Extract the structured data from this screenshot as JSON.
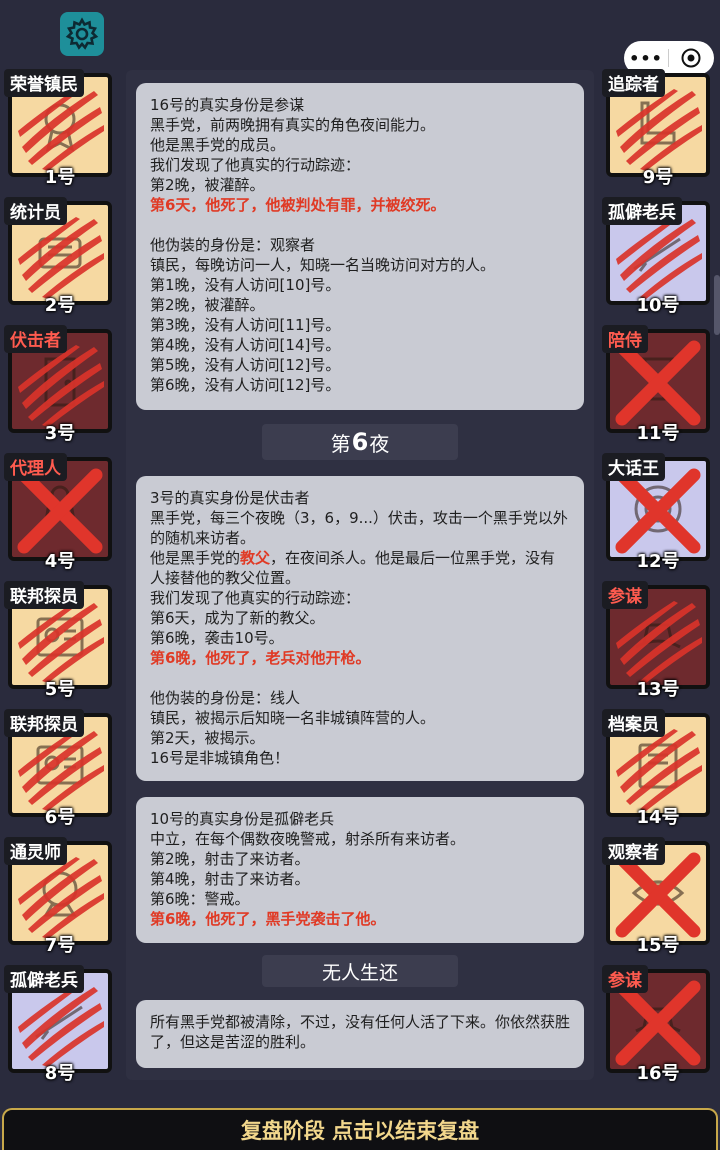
{
  "left_players": [
    {
      "role": "荣誉镇民",
      "number": "1号",
      "bg": "cream",
      "mark": "claw",
      "tag_color": "white",
      "art": "medal"
    },
    {
      "role": "统计员",
      "number": "2号",
      "bg": "cream",
      "mark": "claw",
      "tag_color": "white",
      "art": "box"
    },
    {
      "role": "伏击者",
      "number": "3号",
      "bg": "maroon",
      "mark": "claw",
      "tag_color": "red",
      "art": "door"
    },
    {
      "role": "代理人",
      "number": "4号",
      "bg": "maroon",
      "mark": "cross",
      "tag_color": "red",
      "art": "figure"
    },
    {
      "role": "联邦探员",
      "number": "5号",
      "bg": "cream",
      "mark": "claw",
      "tag_color": "white",
      "art": "badge"
    },
    {
      "role": "联邦探员",
      "number": "6号",
      "bg": "cream",
      "mark": "claw",
      "tag_color": "white",
      "art": "badge"
    },
    {
      "role": "通灵师",
      "number": "7号",
      "bg": "cream",
      "mark": "claw",
      "tag_color": "white",
      "art": "orb"
    },
    {
      "role": "孤僻老兵",
      "number": "8号",
      "bg": "lav",
      "mark": "claw",
      "tag_color": "white",
      "art": "rifle"
    }
  ],
  "right_players": [
    {
      "role": "追踪者",
      "number": "9号",
      "bg": "cream",
      "mark": "claw",
      "tag_color": "white",
      "art": "boot"
    },
    {
      "role": "孤僻老兵",
      "number": "10号",
      "bg": "lav",
      "mark": "claw",
      "tag_color": "white",
      "art": "rifle"
    },
    {
      "role": "陪侍",
      "number": "11号",
      "bg": "maroon",
      "mark": "cross",
      "tag_color": "red",
      "art": "glass"
    },
    {
      "role": "大话王",
      "number": "12号",
      "bg": "lav",
      "mark": "cross",
      "tag_color": "white",
      "art": "plate"
    },
    {
      "role": "参谋",
      "number": "13号",
      "bg": "maroon",
      "mark": "claw",
      "tag_color": "red",
      "art": "hat"
    },
    {
      "role": "档案员",
      "number": "14号",
      "bg": "cream",
      "mark": "claw",
      "tag_color": "white",
      "art": "book"
    },
    {
      "role": "观察者",
      "number": "15号",
      "bg": "cream",
      "mark": "cross",
      "tag_color": "white",
      "art": "eye"
    },
    {
      "role": "参谋",
      "number": "16号",
      "bg": "maroon",
      "mark": "cross",
      "tag_color": "red",
      "art": "hat"
    }
  ],
  "messages": {
    "m1": {
      "l1": "16号的真实身份是参谋",
      "l2": "黑手党，前两晚拥有真实的角色夜间能力。",
      "l3": "他是黑手党的成员。",
      "l4": "我们发现了他真实的行动踪迹：",
      "l5": "第2晚，被灌醉。",
      "l6": "第6天，他死了，他被判处有罪，并被绞死。",
      "l7": "他伪装的身份是：观察者",
      "l8": "镇民，每晚访问一人，知晓一名当晚访问对方的人。",
      "l9": "第1晚，没有人访问[10]号。",
      "l10": "第2晚，被灌醉。",
      "l11": "第3晚，没有人访问[11]号。",
      "l12": "第4晚，没有人访问[14]号。",
      "l13": "第5晚，没有人访问[12]号。",
      "l14": "第6晚，没有人访问[12]号。"
    },
    "night_label_pre": "第",
    "night_label_num": "6",
    "night_label_post": "夜",
    "m2": {
      "l1": "3号的真实身份是伏击者",
      "l2": "黑手党，每三个夜晚（3，6，9...）伏击，攻击一个黑手党以外的随机来访者。",
      "l3a": "他是黑手党的",
      "l3b": "教父",
      "l3c": "，在夜间杀人。他是最后一位黑手党，没有人接替他的教父位置。",
      "l4": "我们发现了他真实的行动踪迹：",
      "l5": "第6天，成为了新的教父。",
      "l6": "第6晚，袭击10号。",
      "l7": "第6晚，他死了，老兵对他开枪。",
      "l8": "他伪装的身份是：线人",
      "l9": "镇民，被揭示后知晓一名非城镇阵营的人。",
      "l10": "第2天，被揭示。",
      "l11": "16号是非城镇角色！"
    },
    "m3": {
      "l1": "10号的真实身份是孤僻老兵",
      "l2": "中立，在每个偶数夜晚警戒，射杀所有来访者。",
      "l3": "第2晚，射击了来访者。",
      "l4": "第4晚，射击了来访者。",
      "l5": "第6晚：警戒。",
      "l6": "第6晚，他死了，黑手党袭击了他。"
    },
    "survivor_label": "无人生还",
    "m4": {
      "l1": "所有黑手党都被清除，不过，没有任何人活了下来。你依然获胜了，但这是苦涩的胜利。"
    }
  },
  "bottom_button": "复盘阶段 点击以结束复盘",
  "capsule": {
    "more": "•••"
  },
  "colors": {
    "accent_red": "#e03a25",
    "gold": "#c8a84a",
    "cream": "#f6d9a2",
    "lavender": "#c9c8ec",
    "maroon": "#6e2a2e"
  }
}
